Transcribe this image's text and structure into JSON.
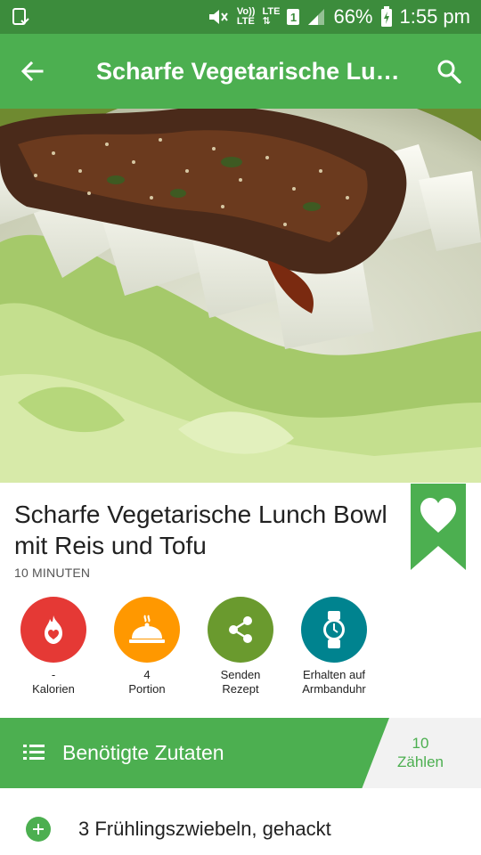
{
  "status_bar": {
    "volte": "Vo))",
    "lte_label": "LTE",
    "lte2": "LTE",
    "sim": "1",
    "battery": "66%",
    "time": "1:55 pm"
  },
  "toolbar": {
    "title": "Scharfe Vegetarische Lunch Bowl mit Reis und Tofu",
    "back_icon": "arrow-left-icon",
    "search_icon": "search-icon"
  },
  "recipe": {
    "title": "Scharfe Vegetarische Lunch Bowl mit Reis und Tofu",
    "time": "10 MINUTEN"
  },
  "actions": [
    {
      "icon": "calorie-flame-icon",
      "line1": "-",
      "line2": "Kalorien",
      "color": "#e53935"
    },
    {
      "icon": "serving-dish-icon",
      "line1": "4",
      "line2": "Portion",
      "color": "#ff9800"
    },
    {
      "icon": "share-icon",
      "line1": "Senden",
      "line2": "Rezept",
      "color": "#6a9a2e"
    },
    {
      "icon": "smartwatch-icon",
      "line1": "Erhalten auf",
      "line2": "Armbanduhr",
      "color": "#00838f"
    }
  ],
  "ingredients": {
    "title": "Benötigte Zutaten",
    "count": "10",
    "count_label": "Zählen",
    "items": [
      "3 Frühlingszwiebeln, gehackt"
    ]
  },
  "colors": {
    "status_bar": "#3c8c3c",
    "toolbar": "#4caf50",
    "accent": "#4caf50"
  }
}
